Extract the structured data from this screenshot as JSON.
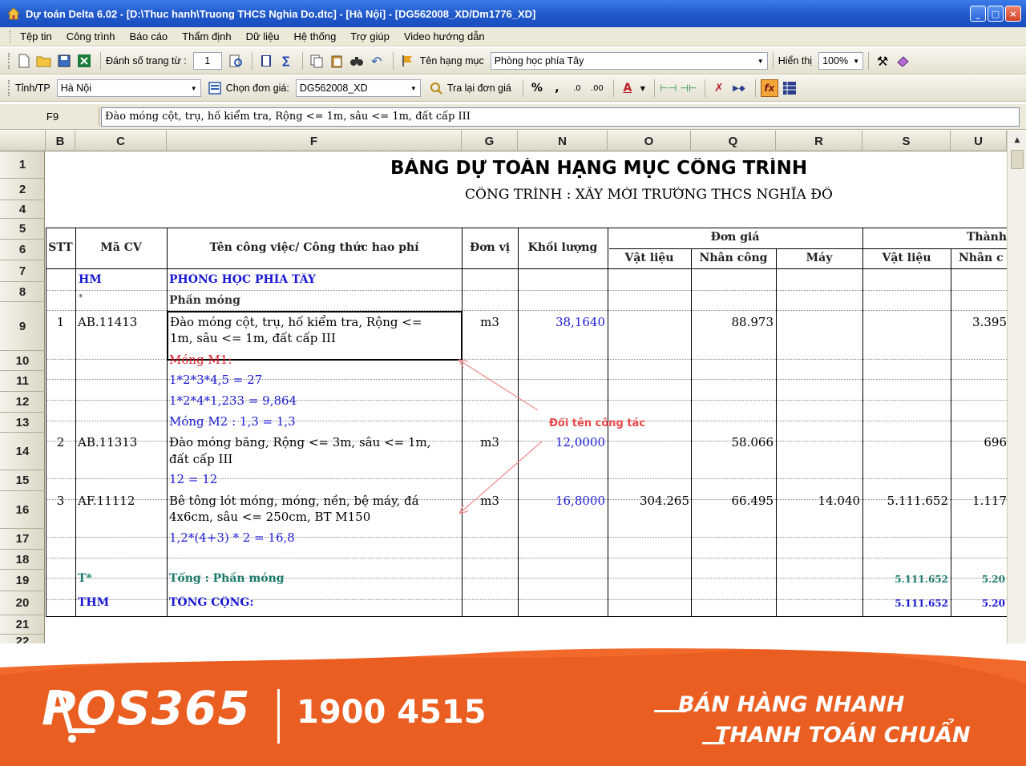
{
  "window": {
    "title": "Dự toán Delta 6.02 - [D:\\Thuc hanh\\Truong THCS Nghia Do.dtc] - [Hà Nội] - [DG562008_XD/Dm1776_XD]"
  },
  "menu": [
    "Tệp tin",
    "Công trình",
    "Báo cáo",
    "Thẩm định",
    "Dữ liệu",
    "Hệ thống",
    "Trợ giúp",
    "Video hướng dẫn"
  ],
  "toolbar1": {
    "page_number_label": "Đánh số trang từ :",
    "page_number_value": "1",
    "item_name_label": "Tên hạng mục",
    "item_name_value": "Phòng học phía Tây",
    "zoom_label": "Hiển thị",
    "zoom_value": "100%"
  },
  "toolbar2": {
    "province_label": "Tỉnh/TP",
    "province_value": "Hà Nội",
    "unit_price_label": "Chọn đơn giá:",
    "unit_price_value": "DG562008_XD",
    "lookup_label": "Tra lại đơn giá",
    "percent_symbol": "%",
    "comma_symbol": ","
  },
  "formula_bar": {
    "cell_ref": "F9",
    "content": "Đào móng cột, trụ, hố kiểm tra, Rộng <= 1m, sâu <= 1m, đất cấp III"
  },
  "columns": [
    "B",
    "C",
    "F",
    "G",
    "N",
    "O",
    "Q",
    "R",
    "S",
    "U"
  ],
  "rows": [
    "1",
    "2",
    "4",
    "5",
    "6",
    "7",
    "8",
    "9",
    "10",
    "11",
    "12",
    "13",
    "14",
    "15",
    "16",
    "17",
    "18",
    "19",
    "20",
    "21",
    "22"
  ],
  "sheet": {
    "title": "BẢNG DỰ TOÁN HẠNG MỤC CÔNG TRÌNH",
    "subtitle": "CÔNG TRÌNH : XÂY MỚI TRƯỜNG THCS NGHĨA ĐÔ",
    "headers": {
      "stt": "STT",
      "ma_cv": "Mã CV",
      "ten_cv": "Tên công việc/ Công thức hao phí",
      "don_vi": "Đơn vị",
      "khoi_luong": "Khối lượng",
      "don_gia": "Đơn giá",
      "thanh_tien": "Thành",
      "vat_lieu": "Vật liệu",
      "nhan_cong": "Nhân công",
      "may": "Máy",
      "vat_lieu2": "Vật liệu",
      "nhan_cong2": "Nhân c"
    },
    "r7": {
      "code": "HM",
      "name": "PHÒNG HỌC PHÍA TÂY"
    },
    "r8": {
      "code": "*",
      "name": "Phần móng"
    },
    "r9": {
      "stt": "1",
      "code": "AB.11413",
      "name1": "Đào móng cột, trụ, hố kiểm tra, Rộng <=",
      "name2": "1m, sâu <= 1m, đất cấp III",
      "unit": "m3",
      "qty": "38,1640",
      "labor": "88.973",
      "total_labor": "3.395"
    },
    "r10": "Móng M1:",
    "r11": "1*2*3*4,5 = 27",
    "r12": "1*2*4*1,233 = 9,864",
    "r13": "Móng M2 : 1,3 = 1,3",
    "r14": {
      "stt": "2",
      "code": "AB.11313",
      "name1": "Đào móng băng, Rộng <= 3m, sâu <= 1m,",
      "name2": "đất cấp III",
      "unit": "m3",
      "qty": "12,0000",
      "labor": "58.066",
      "total_labor": "696"
    },
    "r15": "12 = 12",
    "r16": {
      "stt": "3",
      "code": "AF.11112",
      "name1": "Bê tông lót móng, móng, nền, bệ máy, đá",
      "name2": "4x6cm, sâu <= 250cm, BT M150",
      "unit": "m3",
      "qty": "16,8000",
      "material": "304.265",
      "labor": "66.495",
      "machine": "14.040",
      "total_material": "5.111.652",
      "total_labor": "1.117"
    },
    "r17": "1,2*(4+3) * 2 = 16,8",
    "r19": {
      "code": "T*",
      "name": "Tổng : Phần móng",
      "total_material": "5.111.652",
      "total_labor": "5.20"
    },
    "r20": {
      "code": "THM",
      "name": "TỔNG CỘNG:",
      "total_material": "5.111.652",
      "total_labor": "5.20"
    },
    "annotation": "Đổi tên công tác"
  },
  "banner": {
    "brand": "POS365",
    "hotline": "1900 4515",
    "slogan1": "BÁN HÀNG NHANH",
    "slogan2": "THANH TOÁN CHUẨN"
  },
  "colors": {
    "titlebar": "#1f57c9",
    "chrome": "#ece9d8",
    "blue_text": "#1919d4",
    "red_text": "#e0202a",
    "banner": "#f26a2b"
  }
}
